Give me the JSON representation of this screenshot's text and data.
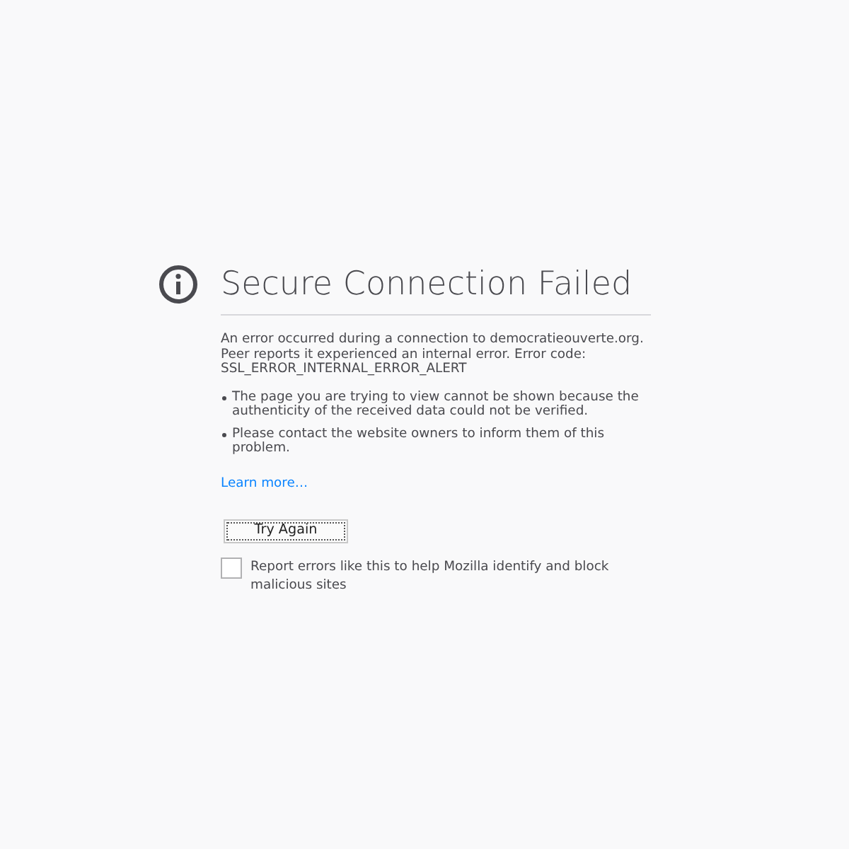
{
  "title": "Secure Connection Failed",
  "message": "An error occurred during a connection to democratieouverte.org. Peer reports it experienced an internal error. Error code: SSL_ERROR_INTERNAL_ERROR_ALERT",
  "bullets": [
    "The page you are trying to view cannot be shown because the authenticity of the received data could not be verified.",
    "Please contact the website owners to inform them of this problem."
  ],
  "learn_more": "Learn more…",
  "try_again": "Try Again",
  "report": {
    "label": "Report errors like this to help Mozilla identify and block malicious sites",
    "checked": false
  }
}
